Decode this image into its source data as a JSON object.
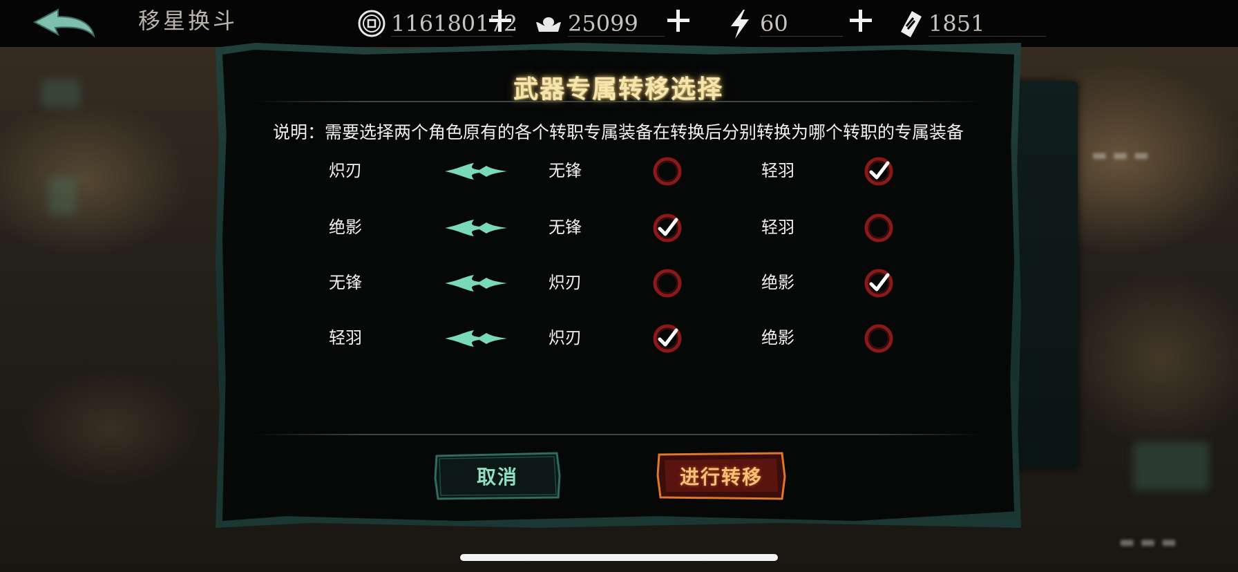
{
  "topbar": {
    "title": "移星换斗",
    "resources": [
      {
        "icon": "coin-icon",
        "value": "116180172"
      },
      {
        "icon": "silver-ingot-icon",
        "value": "25099"
      },
      {
        "icon": "lightning-energy-icon",
        "value": "60"
      },
      {
        "icon": "ticket-icon",
        "value": "1851"
      }
    ]
  },
  "dialog": {
    "title": "武器专属转移选择",
    "description": "说明：需要选择两个角色原有的各个转职专属装备在转换后分别转换为哪个转职的专属装备",
    "rows": [
      {
        "from": "炽刃",
        "option_a": "无锋",
        "option_a_selected": false,
        "option_b": "轻羽",
        "option_b_selected": true
      },
      {
        "from": "绝影",
        "option_a": "无锋",
        "option_a_selected": true,
        "option_b": "轻羽",
        "option_b_selected": false
      },
      {
        "from": "无锋",
        "option_a": "炽刃",
        "option_a_selected": false,
        "option_b": "绝影",
        "option_b_selected": true
      },
      {
        "from": "轻羽",
        "option_a": "炽刃",
        "option_a_selected": true,
        "option_b": "绝影",
        "option_b_selected": false
      }
    ],
    "cancel_label": "取消",
    "confirm_label": "进行转移"
  },
  "colors": {
    "title_glow": "#f4e6b0",
    "cancel_text": "#8fe0c0",
    "confirm_text": "#f6c27a",
    "radio_ring": "#8a1a1a",
    "arrow": "#7fe6c4",
    "frame": "#21403c"
  }
}
